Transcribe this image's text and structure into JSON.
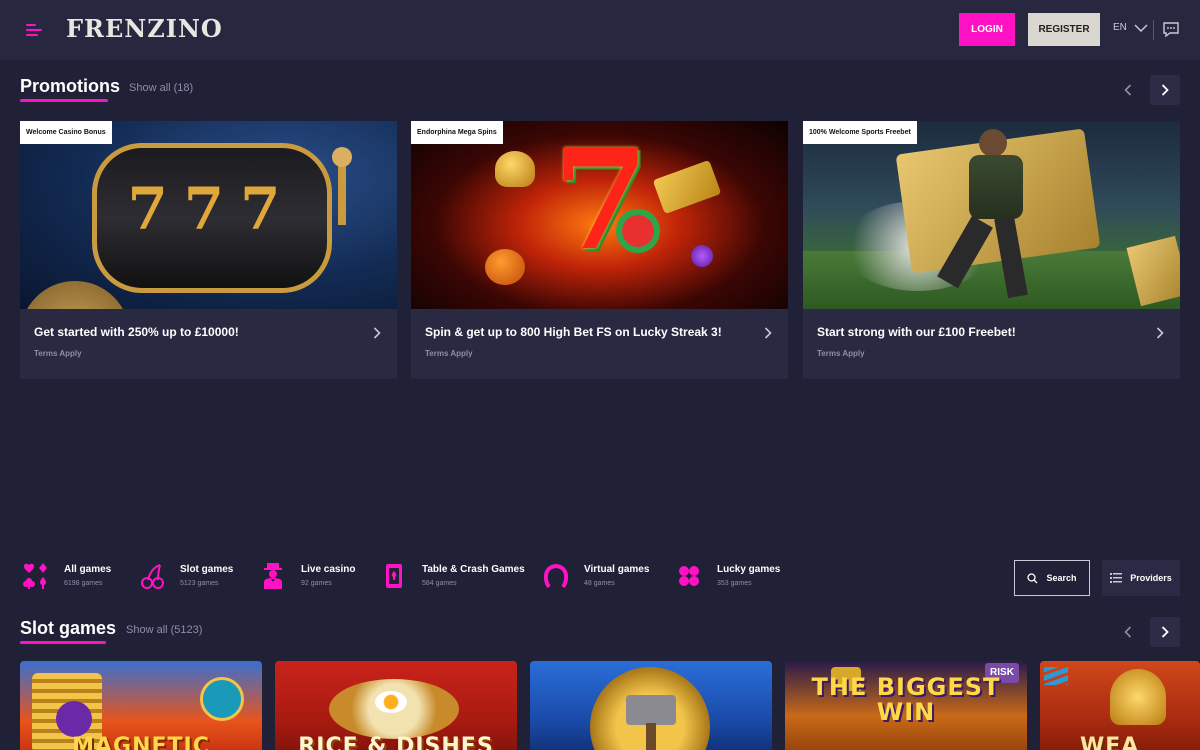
{
  "header": {
    "logo": "FRENZINO",
    "login_label": "LOGIN",
    "register_label": "REGISTER",
    "language": "EN",
    "colors": {
      "accent": "#ff12c4",
      "background": "#202036",
      "header": "#272740"
    }
  },
  "promotions": {
    "title": "Promotions",
    "show_all": "Show all (18)",
    "cards": [
      {
        "tag": "Welcome Casino Bonus",
        "title": "Get started with 250% up to £10000!",
        "terms": "Terms Apply",
        "image_text": "777"
      },
      {
        "tag": "Endorphina Mega Spins",
        "title": "Spin & get up to 800 High Bet FS on Lucky Streak 3!",
        "terms": "Terms Apply",
        "image_text": "7"
      },
      {
        "tag": "100% Welcome Sports Freebet",
        "title": "Start strong with our £100 Freebet!",
        "terms": "Terms Apply"
      }
    ]
  },
  "categories": [
    {
      "name": "All games",
      "count": "6198 games",
      "icon": "card-suits-icon"
    },
    {
      "name": "Slot games",
      "count": "5123 games",
      "icon": "cherries-icon"
    },
    {
      "name": "Live casino",
      "count": "92 games",
      "icon": "dealer-icon"
    },
    {
      "name": "Table & Crash Games",
      "count": "584 games",
      "icon": "cards-icon"
    },
    {
      "name": "Virtual games",
      "count": "48 games",
      "icon": "horseshoe-icon"
    },
    {
      "name": "Lucky games",
      "count": "353 games",
      "icon": "clover-icon"
    }
  ],
  "tools": {
    "search_label": "Search",
    "providers_label": "Providers"
  },
  "slot_games": {
    "title": "Slot games",
    "show_all": "Show all (5123)",
    "tiles": [
      {
        "name": "MAGNETIC"
      },
      {
        "name": "RICE & DISHES"
      },
      {
        "name": ""
      },
      {
        "name": "THE BIGGEST WIN",
        "badge": "RISK"
      },
      {
        "name": "WEA"
      }
    ]
  }
}
